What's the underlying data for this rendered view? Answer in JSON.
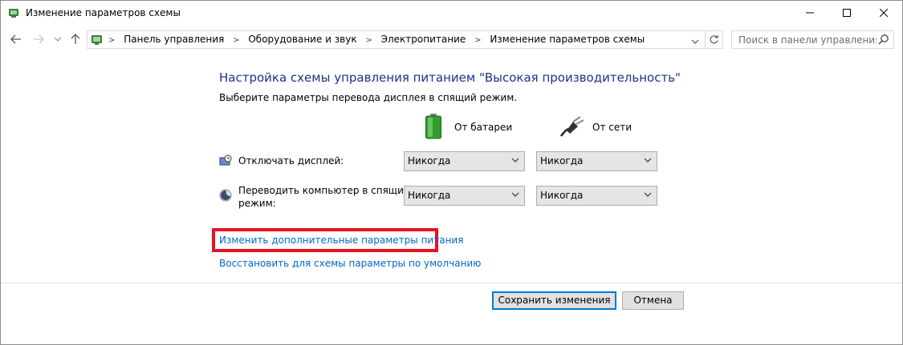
{
  "window": {
    "title": "Изменение параметров схемы"
  },
  "nav": {
    "breadcrumbs": [
      "Панель управления",
      "Оборудование и звук",
      "Электропитание",
      "Изменение параметров схемы"
    ],
    "search_placeholder": "Поиск в панели управления"
  },
  "main": {
    "heading": "Настройка схемы управления питанием \"Высокая производительность\"",
    "subtitle": "Выберите параметры перевода дисплея в спящий режим.",
    "columns": {
      "battery": "От батареи",
      "ac": "От сети"
    },
    "rows": {
      "display": {
        "label": "Отключать дисплей:",
        "battery_value": "Никогда",
        "ac_value": "Никогда"
      },
      "sleep": {
        "label_line1": "Переводить компьютер в спящий",
        "label_line2": "режим:",
        "battery_value": "Никогда",
        "ac_value": "Никогда"
      }
    },
    "links": {
      "advanced": "Изменить дополнительные параметры питания",
      "restore": "Восстановить для схемы параметры по умолчанию"
    }
  },
  "footer": {
    "save_label": "Сохранить изменения",
    "cancel_label": "Отмена"
  },
  "colors": {
    "heading": "#1e3287",
    "link": "#0066cc",
    "highlight": "#e81123",
    "primary_border": "#0078d7"
  }
}
